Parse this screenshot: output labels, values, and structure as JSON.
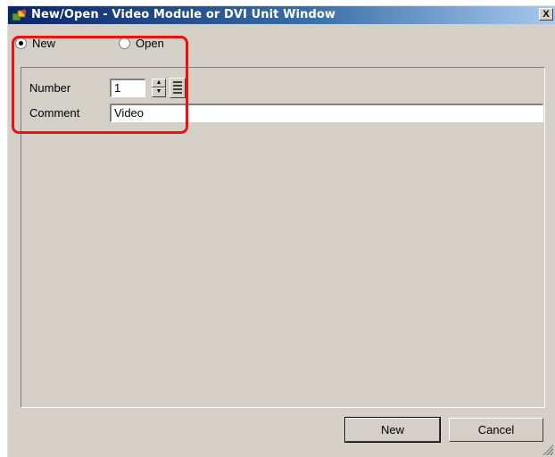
{
  "window": {
    "title": "New/Open - Video Module or DVI Unit Window",
    "close_label": "X"
  },
  "mode": {
    "new_label": "New",
    "open_label": "Open",
    "selected": "New"
  },
  "form": {
    "number_label": "Number",
    "number_value": "1",
    "comment_label": "Comment",
    "comment_value": "Video"
  },
  "buttons": {
    "new_label": "New",
    "cancel_label": "Cancel"
  },
  "colors": {
    "highlight": "#ee1111",
    "title_bar_start": "#0a246a",
    "title_bar_end": "#a6caf0"
  }
}
